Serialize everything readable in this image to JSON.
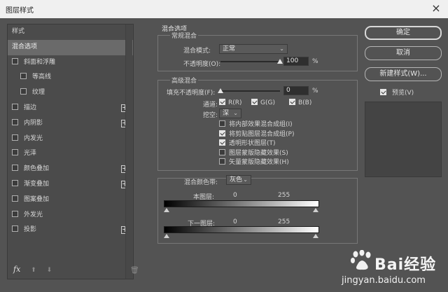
{
  "window": {
    "title": "图层样式",
    "close": "×"
  },
  "left": {
    "header": "样式",
    "items": [
      {
        "label": "混合选项",
        "checkbox": false,
        "checked": false,
        "indent": false,
        "selected": true,
        "plus": false
      },
      {
        "label": "斜面和浮雕",
        "checkbox": true,
        "checked": false,
        "indent": false,
        "selected": false,
        "plus": false
      },
      {
        "label": "等高线",
        "checkbox": true,
        "checked": false,
        "indent": true,
        "selected": false,
        "plus": false
      },
      {
        "label": "纹理",
        "checkbox": true,
        "checked": false,
        "indent": true,
        "selected": false,
        "plus": false
      },
      {
        "label": "描边",
        "checkbox": true,
        "checked": false,
        "indent": false,
        "selected": false,
        "plus": true
      },
      {
        "label": "内阴影",
        "checkbox": true,
        "checked": false,
        "indent": false,
        "selected": false,
        "plus": true
      },
      {
        "label": "内发光",
        "checkbox": true,
        "checked": false,
        "indent": false,
        "selected": false,
        "plus": false
      },
      {
        "label": "光泽",
        "checkbox": true,
        "checked": false,
        "indent": false,
        "selected": false,
        "plus": false
      },
      {
        "label": "颜色叠加",
        "checkbox": true,
        "checked": false,
        "indent": false,
        "selected": false,
        "plus": true
      },
      {
        "label": "渐变叠加",
        "checkbox": true,
        "checked": false,
        "indent": false,
        "selected": false,
        "plus": true
      },
      {
        "label": "图案叠加",
        "checkbox": true,
        "checked": false,
        "indent": false,
        "selected": false,
        "plus": false
      },
      {
        "label": "外发光",
        "checkbox": true,
        "checked": false,
        "indent": false,
        "selected": false,
        "plus": false
      },
      {
        "label": "投影",
        "checkbox": true,
        "checked": false,
        "indent": false,
        "selected": false,
        "plus": true
      }
    ],
    "footer": {
      "fx": "fx",
      "up": "⬆",
      "down": "⬇",
      "trash": "🗑"
    }
  },
  "blend": {
    "section_title": "混合选项",
    "general_title": "常规混合",
    "mode_label": "混合模式:",
    "mode_value": "正常",
    "opacity_label": "不透明度(O):",
    "opacity_value": "100",
    "opacity_unit": "%",
    "opacity_fraction": 1.0
  },
  "advanced": {
    "title": "高级混合",
    "fill_label": "填充不透明度(F):",
    "fill_value": "0",
    "fill_unit": "%",
    "fill_fraction": 0.0,
    "channels_label": "通道:",
    "channels": [
      {
        "label": "R(R)",
        "checked": true
      },
      {
        "label": "G(G)",
        "checked": true
      },
      {
        "label": "B(B)",
        "checked": true
      }
    ],
    "knockout_label": "挖空:",
    "knockout_value": "深",
    "options": [
      {
        "label": "将内部效果混合成组(I)",
        "checked": false
      },
      {
        "label": "将剪贴图层混合成组(P)",
        "checked": true
      },
      {
        "label": "透明形状图层(T)",
        "checked": true
      },
      {
        "label": "图层蒙版隐藏效果(S)",
        "checked": false
      },
      {
        "label": "矢量蒙版隐藏效果(H)",
        "checked": false
      }
    ]
  },
  "blendif": {
    "label": "混合颜色带:",
    "value": "灰色",
    "this_layer_label": "本图层:",
    "this_min": "0",
    "this_max": "255",
    "under_layer_label": "下一图层:",
    "under_min": "0",
    "under_max": "255"
  },
  "buttons": {
    "ok": "确定",
    "cancel": "取消",
    "new_style": "新建样式(W)...",
    "preview_label": "预览(V)",
    "preview_checked": true
  },
  "watermark": {
    "brand": "Bai经验",
    "url": "jingyan.baidu.com"
  }
}
